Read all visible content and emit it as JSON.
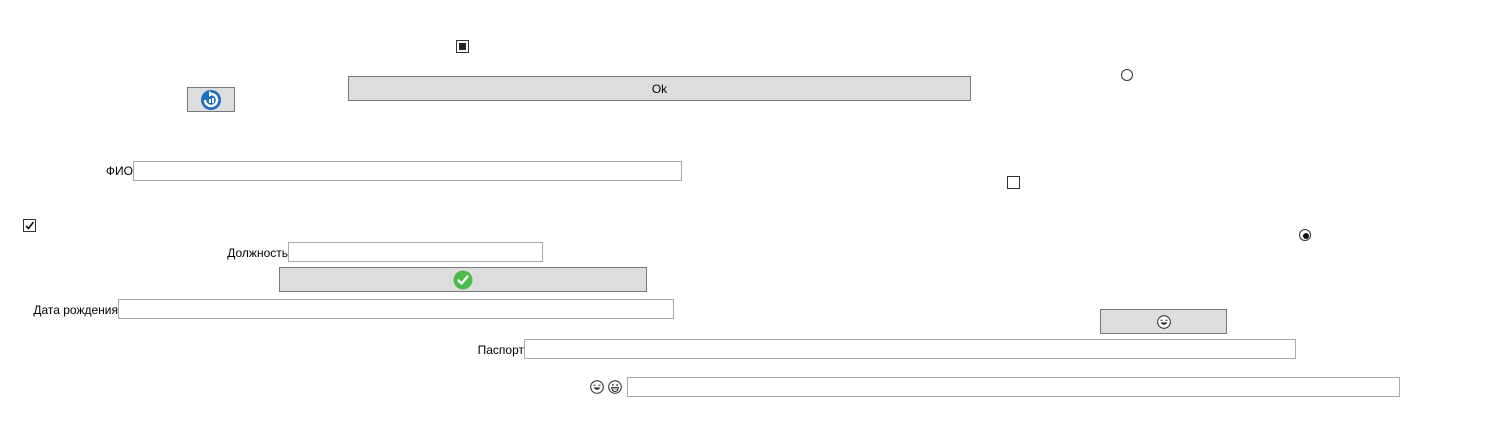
{
  "buttons": {
    "ok_label": "Ok",
    "refresh_icon": "refresh-icon",
    "confirm_icon": "checkmark-icon",
    "emoji_icon": "laughing-face-icon"
  },
  "form": {
    "fio_label": "ФИО",
    "fio_value": "",
    "position_label": "Должность",
    "position_value": "",
    "birthdate_label": "Дата рождения",
    "birthdate_value": "",
    "passport_label": "Паспорт",
    "passport_value": "",
    "emoji_field_value": ""
  },
  "controls": {
    "checkbox_top_state": "indeterminate",
    "checkbox_left_state": "checked",
    "checkbox_right_state": "unchecked",
    "radio_top_state": "unselected",
    "radio_right_state": "selected"
  },
  "colors": {
    "button_bg": "#dddddd",
    "refresh_blue": "#1e6fc0",
    "confirm_green": "#4dbb4a"
  }
}
